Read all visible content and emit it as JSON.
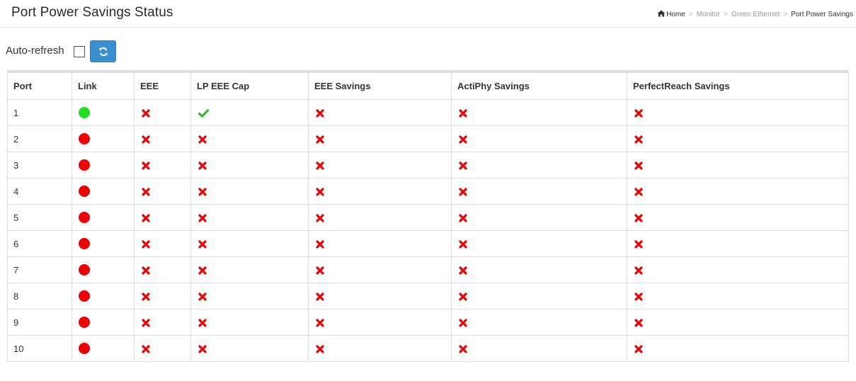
{
  "header": {
    "title": "Port Power Savings Status",
    "breadcrumb": [
      "Home",
      "Monitor",
      "Green Ethernet",
      "Port Power Savings"
    ]
  },
  "toolbar": {
    "auto_refresh_label": "Auto-refresh",
    "auto_refresh_checked": false,
    "refresh_icon": "refresh-icon"
  },
  "colors": {
    "link_up": "#22dd22",
    "link_down": "#ee0000",
    "check": "#2fbf2f",
    "cross": "#ee0000",
    "button": "#3a8fd0"
  },
  "table": {
    "columns": [
      "Port",
      "Link",
      "EEE",
      "LP EEE Cap",
      "EEE Savings",
      "ActiPhy Savings",
      "PerfectReach Savings"
    ],
    "rows": [
      {
        "port": "1",
        "link": "up",
        "eee": "no",
        "lp_eee_cap": "yes",
        "eee_savings": "no",
        "actiphy_savings": "no",
        "perfectreach_savings": "no"
      },
      {
        "port": "2",
        "link": "down",
        "eee": "no",
        "lp_eee_cap": "no",
        "eee_savings": "no",
        "actiphy_savings": "no",
        "perfectreach_savings": "no"
      },
      {
        "port": "3",
        "link": "down",
        "eee": "no",
        "lp_eee_cap": "no",
        "eee_savings": "no",
        "actiphy_savings": "no",
        "perfectreach_savings": "no"
      },
      {
        "port": "4",
        "link": "down",
        "eee": "no",
        "lp_eee_cap": "no",
        "eee_savings": "no",
        "actiphy_savings": "no",
        "perfectreach_savings": "no"
      },
      {
        "port": "5",
        "link": "down",
        "eee": "no",
        "lp_eee_cap": "no",
        "eee_savings": "no",
        "actiphy_savings": "no",
        "perfectreach_savings": "no"
      },
      {
        "port": "6",
        "link": "down",
        "eee": "no",
        "lp_eee_cap": "no",
        "eee_savings": "no",
        "actiphy_savings": "no",
        "perfectreach_savings": "no"
      },
      {
        "port": "7",
        "link": "down",
        "eee": "no",
        "lp_eee_cap": "no",
        "eee_savings": "no",
        "actiphy_savings": "no",
        "perfectreach_savings": "no"
      },
      {
        "port": "8",
        "link": "down",
        "eee": "no",
        "lp_eee_cap": "no",
        "eee_savings": "no",
        "actiphy_savings": "no",
        "perfectreach_savings": "no"
      },
      {
        "port": "9",
        "link": "down",
        "eee": "no",
        "lp_eee_cap": "no",
        "eee_savings": "no",
        "actiphy_savings": "no",
        "perfectreach_savings": "no"
      },
      {
        "port": "10",
        "link": "down",
        "eee": "no",
        "lp_eee_cap": "no",
        "eee_savings": "no",
        "actiphy_savings": "no",
        "perfectreach_savings": "no"
      }
    ]
  }
}
